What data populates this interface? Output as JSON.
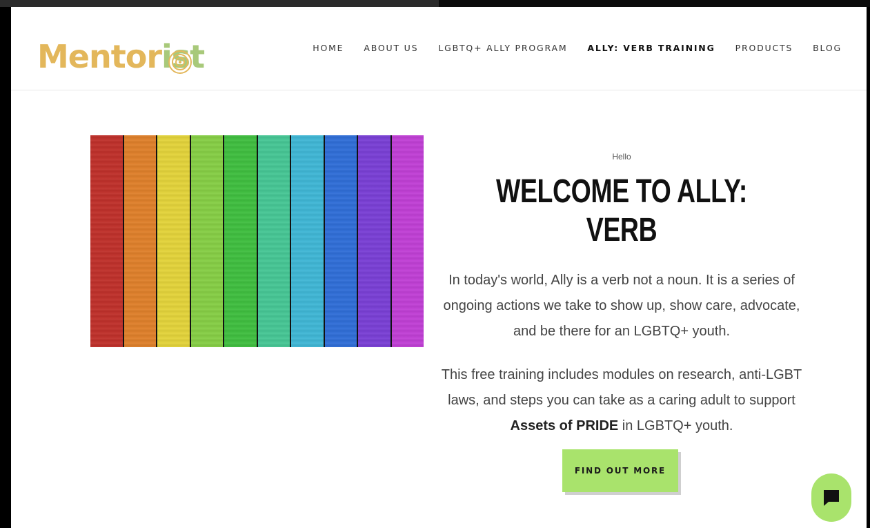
{
  "header": {
    "logo": {
      "part_a": "Mentor",
      "part_b": "ist"
    },
    "nav": [
      {
        "label": "HOME",
        "active": false
      },
      {
        "label": "ABOUT US",
        "active": false
      },
      {
        "label": "LGBTQ+ ALLY PROGRAM",
        "active": false
      },
      {
        "label": "ALLY: VERB TRAINING",
        "active": true
      },
      {
        "label": "PRODUCTS",
        "active": false
      },
      {
        "label": "BLOG",
        "active": false
      }
    ]
  },
  "hero": {
    "image_icon": "rainbow-planks-image",
    "plank_colors": [
      "#c0302a",
      "#e0802a",
      "#e4d43a",
      "#86cf45",
      "#3fbf3f",
      "#46c795",
      "#3fb7d6",
      "#2f6ed8",
      "#7a3fd6",
      "#c13fd6"
    ],
    "eyebrow": "Hello",
    "title": "WELCOME TO ALLY: VERB",
    "paragraph_1": "In today's world, Ally is a verb not a noun. It is a series of ongoing actions we take to show up, show care, advocate, and be there for an LGBTQ+ youth.",
    "paragraph_2_before": "This free training includes modules on research, anti-LGBT laws, and steps you can take as a caring adult to support ",
    "paragraph_2_bold": "Assets of PRIDE",
    "paragraph_2_after": " in LGBTQ+ youth.",
    "cta_label": "FIND OUT MORE"
  },
  "chat": {
    "icon": "chat-bubble-icon",
    "color": "#a9e36c"
  },
  "colors": {
    "accent": "#a9e36c",
    "logo_gold": "#e3b75b",
    "logo_green": "#a8c97a"
  }
}
